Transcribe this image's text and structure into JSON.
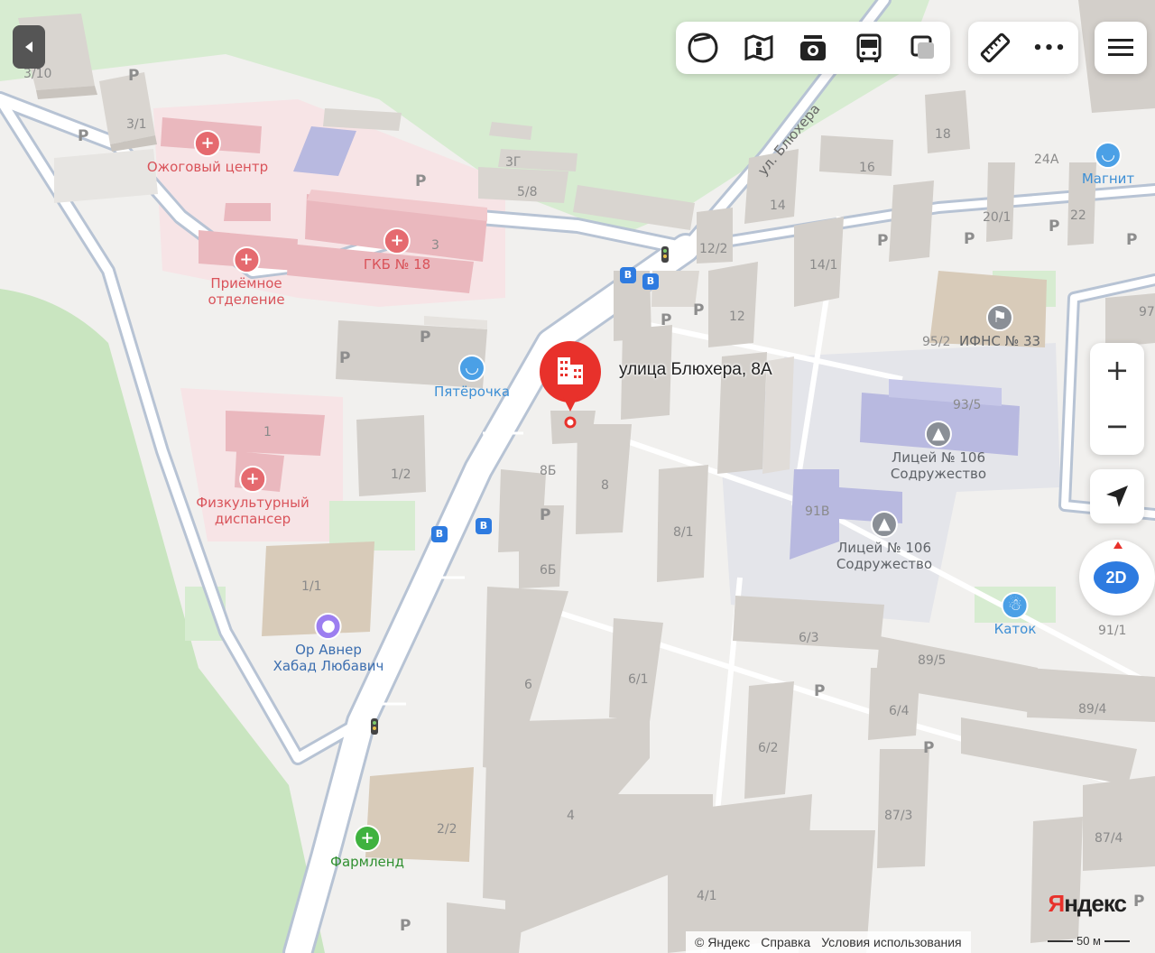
{
  "toolbar": {
    "items": [
      {
        "name": "layers-icon"
      },
      {
        "name": "panorama-icon"
      },
      {
        "name": "photo-icon"
      },
      {
        "name": "transit-icon"
      },
      {
        "name": "overlay-icon"
      }
    ],
    "extra": [
      {
        "name": "ruler-icon"
      },
      {
        "name": "more-icon",
        "glyph": "•••"
      }
    ]
  },
  "controls": {
    "zoom_in": "+",
    "zoom_out": "−",
    "mode": "2D"
  },
  "pin": {
    "label": "улица Блюхера, 8А",
    "color": "#e8312b"
  },
  "pois": {
    "burn_center": "Ожоговый центр",
    "hospital": "ГКБ № 18",
    "reception_1": "Приёмное",
    "reception_2": "отделение",
    "pyaterochka": "Пятёрочка",
    "sport_1": "Физкультурный",
    "sport_2": "диспансер",
    "or_avner_1": "Ор Авнер",
    "or_avner_2": "Хабад Любавич",
    "farmlend": "Фармленд",
    "magnit": "Магнит",
    "ifns": "ИФНС № 33",
    "lyceum_a_1": "Лицей № 106",
    "lyceum_a_2": "Содружество",
    "lyceum_b_1": "Лицей № 106",
    "lyceum_b_2": "Содружество",
    "katok": "Каток"
  },
  "street": "ул. Блюхера",
  "parking": "P",
  "buildings": {
    "b3_10": "3/10",
    "b3_1": "3/1",
    "b3g": "3Г",
    "b5_8": "5/8",
    "b3": "3",
    "b1": "1",
    "b1_2": "1/2",
    "b1_1": "1/1",
    "b8b": "8Б",
    "b8": "8",
    "b6b": "6Б",
    "b8_1": "8/1",
    "b6": "6",
    "b6_1": "6/1",
    "b4": "4",
    "b2_2": "2/2",
    "b4_1": "4/1",
    "b12_2": "12/2",
    "b12": "12",
    "b14": "14",
    "b14_1": "14/1",
    "b16": "16",
    "b18": "18",
    "b20_1": "20/1",
    "b22": "22",
    "b24a": "24А",
    "b95_2": "95/2",
    "b93_5": "93/5",
    "b91v": "91В",
    "b6_3": "6/3",
    "b89_5": "89/5",
    "b6_4": "6/4",
    "b6_2": "6/2",
    "b87_3": "87/3",
    "b87_4": "87/4",
    "b89_4": "89/4",
    "b91_1": "91/1",
    "b97": "97"
  },
  "footer": {
    "copyright": "© Яндекс",
    "help": "Справка",
    "terms": "Условия использования"
  },
  "logo": {
    "first": "Я",
    "rest": "ндекс"
  },
  "scale": "50 м",
  "colors": {
    "park": "#d7ecd1",
    "forest": "#c9e5c0",
    "road": "#ffffff",
    "road_edge": "#b7c3d4",
    "building": "#e2dfdb",
    "building_roof": "#d8d4cf",
    "hospital_zone": "#f7e4e6",
    "hospital_building": "#eab8be",
    "school_building": "#b8b9e0",
    "accent": "#e8312b"
  }
}
